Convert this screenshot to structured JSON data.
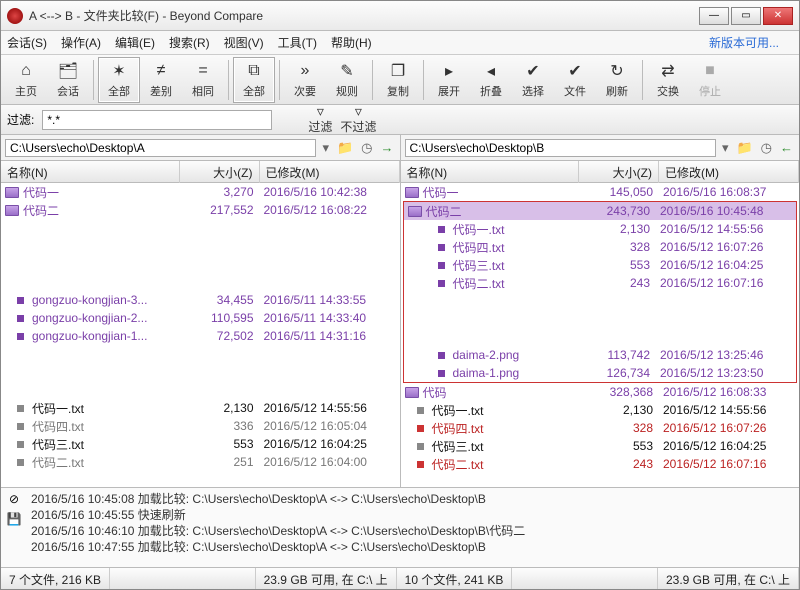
{
  "title": "A <--> B - 文件夹比较(F) - Beyond Compare",
  "menu": [
    "会话(S)",
    "操作(A)",
    "编辑(E)",
    "搜索(R)",
    "视图(V)",
    "工具(T)",
    "帮助(H)"
  ],
  "update_link": "新版本可用...",
  "toolbar": [
    {
      "label": "主页",
      "glyph": "⌂"
    },
    {
      "label": "会话",
      "glyph": "🗂"
    },
    {
      "sep": true
    },
    {
      "label": "全部",
      "glyph": "✶",
      "boxed": true
    },
    {
      "label": "差别",
      "glyph": "≠"
    },
    {
      "label": "相同",
      "glyph": "="
    },
    {
      "sep": true
    },
    {
      "label": "全部",
      "glyph": "⧉",
      "boxed": true
    },
    {
      "sep": true
    },
    {
      "label": "次要",
      "glyph": "»"
    },
    {
      "label": "规则",
      "glyph": "✎"
    },
    {
      "sep": true
    },
    {
      "label": "复制",
      "glyph": "❐"
    },
    {
      "sep": true
    },
    {
      "label": "展开",
      "glyph": "▸"
    },
    {
      "label": "折叠",
      "glyph": "◂"
    },
    {
      "label": "选择",
      "glyph": "✔"
    },
    {
      "label": "文件",
      "glyph": "✔"
    },
    {
      "label": "刷新",
      "glyph": "↻"
    },
    {
      "sep": true
    },
    {
      "label": "交换",
      "glyph": "⇄"
    },
    {
      "label": "停止",
      "glyph": "■",
      "disabled": true
    }
  ],
  "filter": {
    "label": "过滤:",
    "value": "*.*",
    "btn_filter": "过滤",
    "btn_nofilter": "不过滤"
  },
  "paths": {
    "left": "C:\\Users\\echo\\Desktop\\A",
    "right": "C:\\Users\\echo\\Desktop\\B"
  },
  "columns": {
    "name": "名称(N)",
    "size": "大小(Z)",
    "modified": "已修改(M)"
  },
  "left_rows": [
    {
      "type": "folder",
      "name": "代码一",
      "size": "3,270",
      "date": "2016/5/16 10:42:38",
      "cls": "purple"
    },
    {
      "type": "folder",
      "name": "代码二",
      "size": "217,552",
      "date": "2016/5/12 16:08:22",
      "cls": "purple"
    },
    {
      "type": "gap"
    },
    {
      "type": "gap"
    },
    {
      "type": "gap"
    },
    {
      "type": "gap"
    },
    {
      "type": "file",
      "name": "gongzuo-kongjian-3...",
      "size": "34,455",
      "date": "2016/5/11 14:33:55",
      "cls": "purple",
      "sq": "purple"
    },
    {
      "type": "file",
      "name": "gongzuo-kongjian-2...",
      "size": "110,595",
      "date": "2016/5/11 14:33:40",
      "cls": "purple",
      "sq": "purple"
    },
    {
      "type": "file",
      "name": "gongzuo-kongjian-1...",
      "size": "72,502",
      "date": "2016/5/11 14:31:16",
      "cls": "purple",
      "sq": "purple"
    },
    {
      "type": "gap"
    },
    {
      "type": "gap"
    },
    {
      "type": "gap"
    },
    {
      "type": "file",
      "name": "代码一.txt",
      "size": "2,130",
      "date": "2016/5/12 14:55:56",
      "cls": "black",
      "sq": "gray"
    },
    {
      "type": "file",
      "name": "代码四.txt",
      "size": "336",
      "date": "2016/5/12 16:05:04",
      "cls": "gray",
      "sq": "gray"
    },
    {
      "type": "file",
      "name": "代码三.txt",
      "size": "553",
      "date": "2016/5/12 16:04:25",
      "cls": "black",
      "sq": "gray"
    },
    {
      "type": "file",
      "name": "代码二.txt",
      "size": "251",
      "date": "2016/5/12 16:04:00",
      "cls": "gray",
      "sq": "gray"
    }
  ],
  "right_rows": [
    {
      "type": "folder",
      "name": "代码一",
      "size": "145,050",
      "date": "2016/5/16 16:08:37",
      "cls": "purple"
    },
    {
      "type": "folder",
      "name": "代码二",
      "size": "243,730",
      "date": "2016/5/16 10:45:48",
      "cls": "purple",
      "sel": true,
      "boxstart": true
    },
    {
      "type": "file",
      "name": "代码一.txt",
      "size": "2,130",
      "date": "2016/5/12 14:55:56",
      "cls": "purple",
      "sq": "purple",
      "indent": true
    },
    {
      "type": "file",
      "name": "代码四.txt",
      "size": "328",
      "date": "2016/5/12 16:07:26",
      "cls": "purple",
      "sq": "purple",
      "indent": true
    },
    {
      "type": "file",
      "name": "代码三.txt",
      "size": "553",
      "date": "2016/5/12 16:04:25",
      "cls": "purple",
      "sq": "purple",
      "indent": true
    },
    {
      "type": "file",
      "name": "代码二.txt",
      "size": "243",
      "date": "2016/5/12 16:07:16",
      "cls": "purple",
      "sq": "purple",
      "indent": true
    },
    {
      "type": "gap"
    },
    {
      "type": "gap"
    },
    {
      "type": "gap"
    },
    {
      "type": "file",
      "name": "daima-2.png",
      "size": "113,742",
      "date": "2016/5/12 13:25:46",
      "cls": "purple",
      "sq": "purple",
      "indent": true
    },
    {
      "type": "file",
      "name": "daima-1.png",
      "size": "126,734",
      "date": "2016/5/12 13:23:50",
      "cls": "purple",
      "sq": "purple",
      "indent": true,
      "boxend": true
    },
    {
      "type": "folder",
      "name": "代码",
      "size": "328,368",
      "date": "2016/5/12 16:08:33",
      "cls": "purple"
    },
    {
      "type": "file",
      "name": "代码一.txt",
      "size": "2,130",
      "date": "2016/5/12 14:55:56",
      "cls": "black",
      "sq": "gray"
    },
    {
      "type": "file",
      "name": "代码四.txt",
      "size": "328",
      "date": "2016/5/12 16:07:26",
      "cls": "red",
      "sq": "red"
    },
    {
      "type": "file",
      "name": "代码三.txt",
      "size": "553",
      "date": "2016/5/12 16:04:25",
      "cls": "black",
      "sq": "gray"
    },
    {
      "type": "file",
      "name": "代码二.txt",
      "size": "243",
      "date": "2016/5/12 16:07:16",
      "cls": "red",
      "sq": "red"
    }
  ],
  "log": [
    "2016/5/16 10:45:08  加载比较: C:\\Users\\echo\\Desktop\\A <-> C:\\Users\\echo\\Desktop\\B",
    "2016/5/16 10:45:55  快速刷新",
    "2016/5/16 10:46:10  加载比较: C:\\Users\\echo\\Desktop\\A <-> C:\\Users\\echo\\Desktop\\B\\代码二",
    "2016/5/16 10:47:55  加载比较: C:\\Users\\echo\\Desktop\\A <-> C:\\Users\\echo\\Desktop\\B"
  ],
  "status": {
    "left_count": "7 个文件, 216 KB",
    "left_disk": "23.9 GB 可用, 在 C:\\ 上",
    "right_count": "10 个文件, 241 KB",
    "right_disk": "23.9 GB 可用, 在 C:\\ 上"
  }
}
